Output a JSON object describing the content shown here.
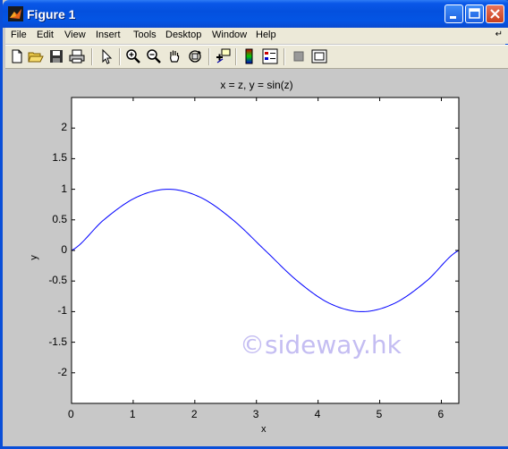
{
  "window": {
    "title": "Figure 1"
  },
  "menu": [
    "File",
    "Edit",
    "View",
    "Insert",
    "Tools",
    "Desktop",
    "Window",
    "Help"
  ],
  "menu_overflow_icon": "dock-arrow-icon",
  "toolbar": {
    "buttons": [
      "new-file-icon",
      "open-folder-icon",
      "save-icon",
      "print-icon",
      "pointer-icon",
      "zoom-in-icon",
      "zoom-out-icon",
      "pan-hand-icon",
      "rotate-3d-icon",
      "data-cursor-icon",
      "colorbar-icon",
      "legend-icon",
      "hide-plot-tools-icon",
      "show-plot-tools-icon"
    ]
  },
  "plot": {
    "title": "x = z, y = sin(z)",
    "watermark": "©sideway.hk"
  },
  "chart_data": {
    "type": "line",
    "title": "x = z, y = sin(z)",
    "xlabel": "x",
    "ylabel": "y",
    "xlim": [
      0,
      6.2832
    ],
    "ylim": [
      -2.5,
      2.5
    ],
    "xticks": [
      "0",
      "1",
      "2",
      "3",
      "4",
      "5",
      "6"
    ],
    "yticks": [
      "-2",
      "-1.5",
      "-1",
      "-0.5",
      "0",
      "0.5",
      "1",
      "1.5",
      "2"
    ],
    "grid": false,
    "line_color": "#0000ff",
    "series": [
      {
        "x": [
          0,
          0.5236,
          1.0472,
          1.5708,
          2.0944,
          2.618,
          3.1416,
          3.6652,
          4.1888,
          4.7124,
          5.236,
          5.7596,
          6.2832
        ],
        "values": [
          0,
          0.5,
          0.866,
          1,
          0.866,
          0.5,
          0,
          -0.5,
          -0.866,
          -1,
          -0.866,
          -0.5,
          0
        ]
      }
    ]
  },
  "colors": {
    "titlebar": "#0450de",
    "figure_bg": "#c8c8c8",
    "axes_bg": "#ffffff",
    "line": "#0000ff"
  }
}
